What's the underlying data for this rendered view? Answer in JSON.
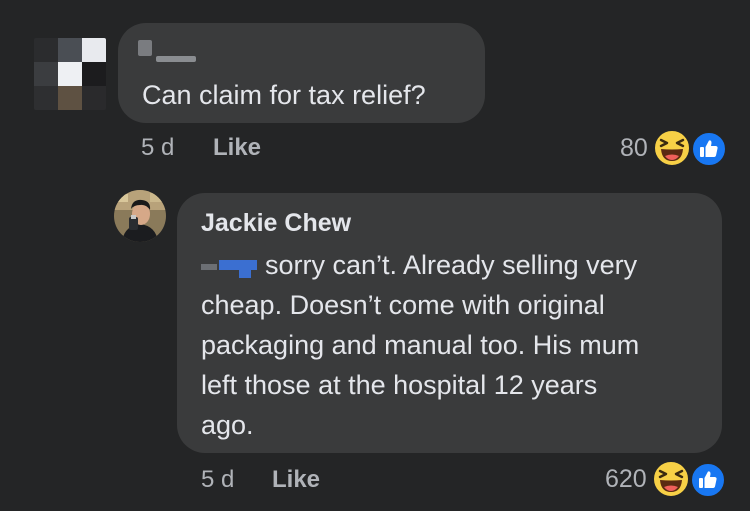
{
  "comment1": {
    "text": "Can claim for tax relief?",
    "time": "5 d",
    "like_label": "Like",
    "reaction_count": "80",
    "reaction_icons": [
      "haha-emoji-icon",
      "like-thumb-icon"
    ]
  },
  "reply": {
    "author": "Jackie Chew",
    "text_lines": [
      "sorry can’t. Already selling very",
      "cheap. Doesn’t come with original",
      "packaging and manual too. His mum",
      "left those at the hospital 12 years",
      "ago."
    ],
    "time": "5 d",
    "like_label": "Like",
    "reaction_count": "620",
    "reaction_icons": [
      "haha-emoji-icon",
      "like-thumb-icon"
    ]
  },
  "colors": {
    "background": "#242526",
    "bubble": "#3a3b3c",
    "text_primary": "#e4e6eb",
    "text_secondary": "#b0b3b8",
    "like_blue": "#1877f2",
    "haha_yellow": "#f7d046"
  }
}
